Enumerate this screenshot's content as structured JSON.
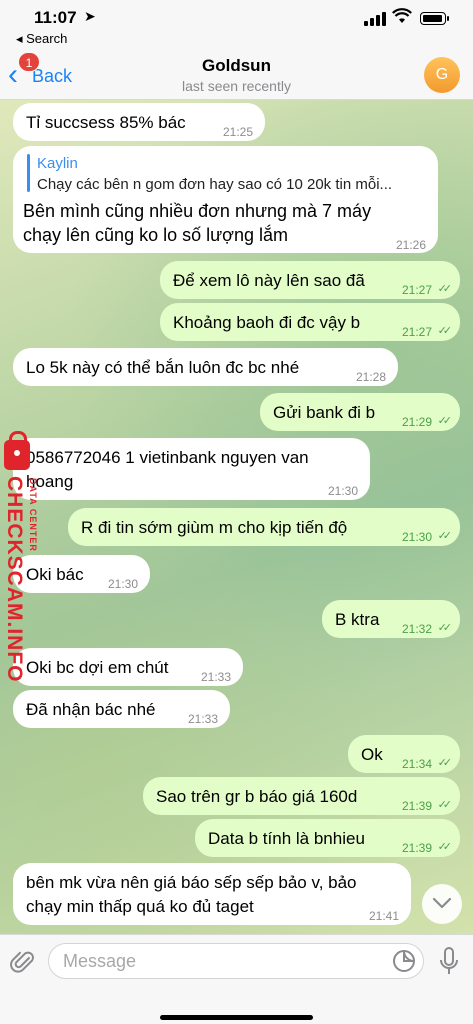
{
  "status_bar": {
    "time": "11:07",
    "back_app": "◂ Search"
  },
  "nav": {
    "back_label": "Back",
    "unread_badge": "1",
    "title": "Goldsun",
    "subtitle": "last seen recently",
    "avatar_letter": "G"
  },
  "messages": [
    {
      "dir": "in",
      "text": "Tỉ succsess 85% bác",
      "time": "21:25"
    },
    {
      "dir": "in",
      "reply_name": "Kaylin",
      "reply_text": "Chạy các bên n gom đơn hay sao có 10 20k tin mỗi...",
      "text1": "Bên mình cũng nhiều đơn nhưng mà 7 máy",
      "text2": "chạy lên cũng ko lo số lượng lắm",
      "time": "21:26"
    },
    {
      "dir": "out",
      "text": "Để xem lô này lên sao đã",
      "time": "21:27"
    },
    {
      "dir": "out",
      "text": "Khoảng baoh đi đc vậy b",
      "time": "21:27"
    },
    {
      "dir": "in",
      "text": "Lo 5k này có thể bắn luôn đc bc nhé",
      "time": "21:28"
    },
    {
      "dir": "out",
      "text": "Gửi bank đi b",
      "time": "21:29"
    },
    {
      "dir": "in",
      "text1": "0586772046 1 vietinbank nguyen van",
      "text2": "hoang",
      "time": "21:30"
    },
    {
      "dir": "out",
      "text": "R đi tin sớm giùm m cho kịp tiến độ",
      "time": "21:30"
    },
    {
      "dir": "in",
      "text": "Oki bác",
      "time": "21:30"
    },
    {
      "dir": "out",
      "text": "B ktra",
      "time": "21:32"
    },
    {
      "dir": "in",
      "text": "Oki bc dợi em chút",
      "time": "21:33"
    },
    {
      "dir": "in",
      "text": "Đã nhận bác nhé",
      "time": "21:33"
    },
    {
      "dir": "out",
      "text": "Ok",
      "time": "21:34"
    },
    {
      "dir": "out",
      "text": "Sao trên gr b báo giá 160d",
      "time": "21:39"
    },
    {
      "dir": "out",
      "text": "Data b tính là bnhieu",
      "time": "21:39"
    },
    {
      "dir": "in",
      "text1": "bên mk vừa nên giá báo sếp sếp bảo v, bảo",
      "text2": "chạy min thấp quá ko đủ taget",
      "time": "21:41"
    }
  ],
  "watermark": {
    "main": "CHECKSCAM.INFO",
    "sub": "DATA CENTER"
  },
  "composer": {
    "placeholder": "Message"
  },
  "colors": {
    "accent": "#1a84f7",
    "outgoing_bubble": "#e3fdc9",
    "incoming_bubble": "#ffffff",
    "read_check": "#4ba04b",
    "watermark": "#e0242c"
  },
  "icons": [
    "location-arrow-icon",
    "signal-icon",
    "wifi-icon",
    "battery-icon",
    "chevron-left-icon",
    "paperclip-icon",
    "sticker-icon",
    "microphone-icon",
    "chevron-down-icon",
    "double-check-icon",
    "lock-icon"
  ]
}
